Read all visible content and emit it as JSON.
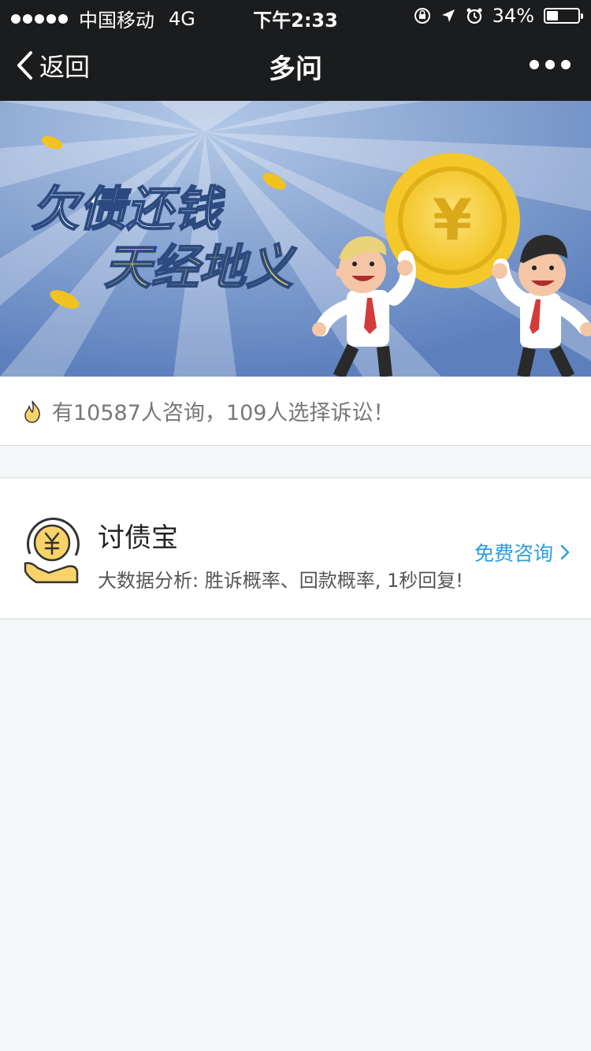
{
  "status_bar": {
    "carrier": "中国移动",
    "network": "4G",
    "time": "下午2:33",
    "battery": "34%",
    "battery_level": 0.34,
    "icons": [
      "orientation-lock-icon",
      "location-arrow-icon",
      "alarm-icon"
    ]
  },
  "nav": {
    "back_label": "返回",
    "title": "多问",
    "more_icon": "more-dots-icon"
  },
  "banner": {
    "line1": "欠债还钱",
    "line2": "天经地义",
    "coin_symbol": "¥"
  },
  "stats": {
    "icon": "flame-icon",
    "text": "有10587人咨询，109人选择诉讼！"
  },
  "service": {
    "icon": "yen-hand-icon",
    "name": "讨债宝",
    "description": "大数据分析: 胜诉概率、回款概率, 1秒回复!",
    "cta_label": "免费咨询",
    "cta_icon": "chevron-right-icon"
  },
  "colors": {
    "nav_bg": "#1b1c1e",
    "accent_blue": "#2a9de2",
    "page_bg": "#f4f7f8",
    "coin_gold": "#f6cf3a",
    "banner_blue": "#6f93c8"
  }
}
